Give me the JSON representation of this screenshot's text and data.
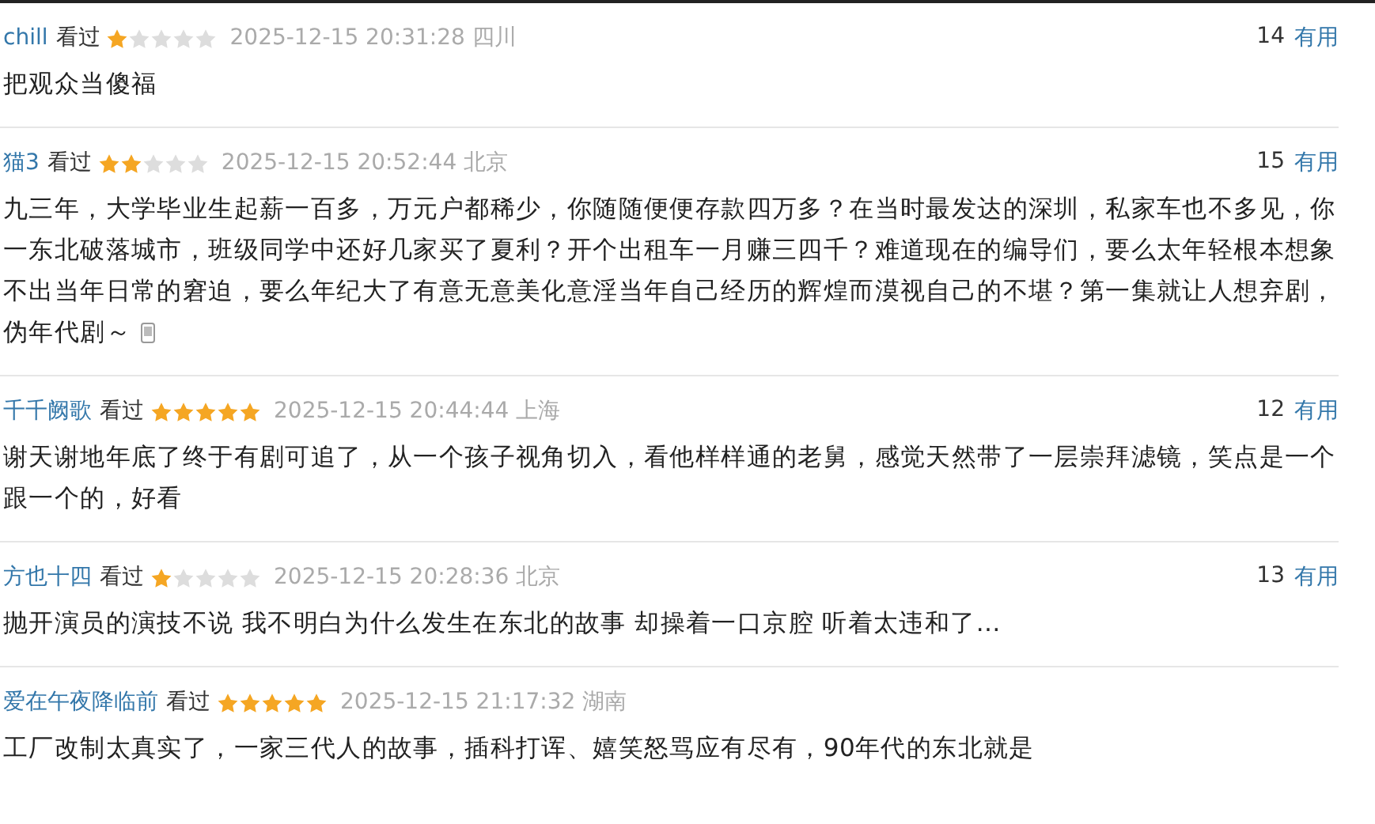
{
  "reviews": [
    {
      "user": "chill",
      "status": "看过",
      "stars": 1,
      "time": "2025-12-15 20:31:28",
      "location": "四川",
      "votes": "14",
      "vote_label": "有用",
      "text": "把观众当傻福",
      "phone_icon": false
    },
    {
      "user": "猫3",
      "status": "看过",
      "stars": 2,
      "time": "2025-12-15 20:52:44",
      "location": "北京",
      "votes": "15",
      "vote_label": "有用",
      "text": "九三年，大学毕业生起薪一百多，万元户都稀少，你随随便便存款四万多？在当时最发达的深圳，私家车也不多见，你一东北破落城市，班级同学中还好几家买了夏利？开个出租车一月赚三四千？难道现在的编导们，要么太年轻根本想象不出当年日常的窘迫，要么年纪大了有意无意美化意淫当年自己经历的辉煌而漠视自己的不堪？第一集就让人想弃剧，伪年代剧～",
      "phone_icon": true
    },
    {
      "user": "千千阙歌",
      "status": "看过",
      "stars": 5,
      "time": "2025-12-15 20:44:44",
      "location": "上海",
      "votes": "12",
      "vote_label": "有用",
      "text": "谢天谢地年底了终于有剧可追了，从一个孩子视角切入，看他样样通的老舅，感觉天然带了一层崇拜滤镜，笑点是一个跟一个的，好看",
      "phone_icon": false
    },
    {
      "user": "方也十四",
      "status": "看过",
      "stars": 1,
      "time": "2025-12-15 20:28:36",
      "location": "北京",
      "votes": "13",
      "vote_label": "有用",
      "text": "抛开演员的演技不说 我不明白为什么发生在东北的故事 却操着一口京腔 听着太违和了…",
      "phone_icon": false
    },
    {
      "user": "爱在午夜降临前",
      "status": "看过",
      "stars": 5,
      "time": "2025-12-15 21:17:32",
      "location": "湖南",
      "text": "工厂改制太真实了，一家三代人的故事，插科打诨、嬉笑怒骂应有尽有，90年代的东北就是",
      "phone_icon": false
    }
  ]
}
